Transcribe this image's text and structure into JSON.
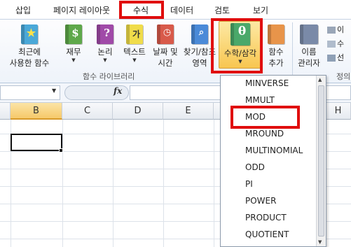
{
  "tabs": [
    {
      "label": "삽입"
    },
    {
      "label": "페이지 레이아웃"
    },
    {
      "label": "수식"
    },
    {
      "label": "데이터"
    },
    {
      "label": "검토"
    },
    {
      "label": "보기"
    }
  ],
  "ribbon": {
    "buttons": [
      {
        "label1": "최근에",
        "label2": "사용한 함수",
        "icon": "book-star-icon",
        "color": "#4aa8d8",
        "glyph": "★"
      },
      {
        "label1": "재무",
        "label2": "",
        "icon": "book-finance-icon",
        "color": "#5ea84a",
        "glyph": "$"
      },
      {
        "label1": "논리",
        "label2": "",
        "icon": "book-logic-icon",
        "color": "#a04aa8",
        "glyph": "?"
      },
      {
        "label1": "텍스트",
        "label2": "",
        "icon": "book-text-icon",
        "color": "#e8d84a",
        "glyph": "가"
      },
      {
        "label1": "날짜 및",
        "label2": "시간",
        "icon": "book-datetime-icon",
        "color": "#d85a4a",
        "glyph": "◷"
      },
      {
        "label1": "찾기/참조",
        "label2": "영역",
        "icon": "book-lookup-icon",
        "color": "#4a8ad8",
        "glyph": "⌕"
      },
      {
        "label1": "수학/삼각",
        "label2": "",
        "icon": "book-math-icon",
        "color": "#4aa86a",
        "glyph": "θ"
      },
      {
        "label1": "함수",
        "label2": "추가",
        "icon": "book-more-icon",
        "color": "#e8944a",
        "glyph": ""
      },
      {
        "label1": "이름",
        "label2": "관리자",
        "icon": "name-manager-icon",
        "color": "#7a8aa8",
        "glyph": ""
      }
    ],
    "group_label": "함수 라이브러리",
    "group_label2": "정의",
    "side_items": [
      "이",
      "수",
      "선"
    ]
  },
  "grid": {
    "columns": [
      "B",
      "C",
      "D",
      "E",
      "H"
    ]
  },
  "dropdown": {
    "items": [
      "MINVERSE",
      "MMULT",
      "MOD",
      "MROUND",
      "MULTINOMIAL",
      "ODD",
      "PI",
      "POWER",
      "PRODUCT",
      "QUOTIENT"
    ]
  },
  "colors": {
    "highlight_red": "#e00d0d",
    "selected_header": "#f6c96a"
  }
}
